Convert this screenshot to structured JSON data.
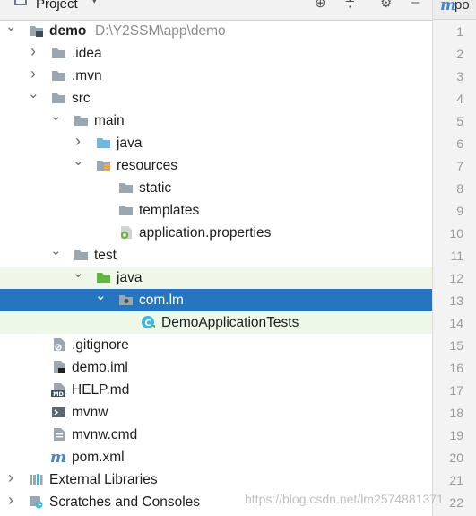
{
  "header": {
    "title": "Project",
    "editor_tab": "po"
  },
  "tree": [
    {
      "id": "demo",
      "label": "demo",
      "path": "D:\\Y2SSM\\app\\demo",
      "bold": true,
      "depth": 0,
      "arrow": "expanded",
      "icon": "module-folder"
    },
    {
      "id": "idea",
      "label": ".idea",
      "depth": 1,
      "arrow": "collapsed",
      "icon": "folder"
    },
    {
      "id": "mvn",
      "label": ".mvn",
      "depth": 1,
      "arrow": "collapsed",
      "icon": "folder"
    },
    {
      "id": "src",
      "label": "src",
      "depth": 1,
      "arrow": "expanded",
      "icon": "folder"
    },
    {
      "id": "main",
      "label": "main",
      "depth": 2,
      "arrow": "expanded",
      "icon": "folder"
    },
    {
      "id": "java-main",
      "label": "java",
      "depth": 3,
      "arrow": "collapsed",
      "icon": "source-folder"
    },
    {
      "id": "resources",
      "label": "resources",
      "depth": 3,
      "arrow": "expanded",
      "icon": "resources-folder"
    },
    {
      "id": "static",
      "label": "static",
      "depth": 4,
      "arrow": "none",
      "icon": "folder"
    },
    {
      "id": "templates",
      "label": "templates",
      "depth": 4,
      "arrow": "none",
      "icon": "folder"
    },
    {
      "id": "app-props",
      "label": "application.properties",
      "depth": 4,
      "arrow": "none",
      "icon": "spring-properties"
    },
    {
      "id": "test",
      "label": "test",
      "depth": 2,
      "arrow": "expanded",
      "icon": "folder"
    },
    {
      "id": "java-test",
      "label": "java",
      "depth": 3,
      "arrow": "expanded",
      "icon": "test-folder",
      "highlight": "green"
    },
    {
      "id": "com-lm",
      "label": "com.lm",
      "depth": 4,
      "arrow": "expanded",
      "icon": "package",
      "selected": true
    },
    {
      "id": "demo-tests",
      "label": "DemoApplicationTests",
      "depth": 5,
      "arrow": "none",
      "icon": "class",
      "highlight": "green"
    },
    {
      "id": "gitignore",
      "label": ".gitignore",
      "depth": 1,
      "arrow": "none",
      "icon": "ignore-file"
    },
    {
      "id": "demo-iml",
      "label": "demo.iml",
      "depth": 1,
      "arrow": "none",
      "icon": "iml-file"
    },
    {
      "id": "help-md",
      "label": "HELP.md",
      "depth": 1,
      "arrow": "none",
      "icon": "markdown-file"
    },
    {
      "id": "mvnw",
      "label": "mvnw",
      "depth": 1,
      "arrow": "none",
      "icon": "shell-file"
    },
    {
      "id": "mvnw-cmd",
      "label": "mvnw.cmd",
      "depth": 1,
      "arrow": "none",
      "icon": "text-file"
    },
    {
      "id": "pom",
      "label": "pom.xml",
      "depth": 1,
      "arrow": "none",
      "icon": "maven-file"
    },
    {
      "id": "ext-libs",
      "label": "External Libraries",
      "depth": 0,
      "arrow": "collapsed",
      "icon": "libraries"
    },
    {
      "id": "scratches",
      "label": "Scratches and Consoles",
      "depth": 0,
      "arrow": "collapsed",
      "icon": "scratches"
    }
  ],
  "gutter": {
    "line_numbers": [
      "1",
      "2",
      "3",
      "4",
      "5",
      "6",
      "7",
      "8",
      "9",
      "10",
      "11",
      "12",
      "13",
      "14",
      "15",
      "16",
      "17",
      "18",
      "19",
      "20",
      "21",
      "22"
    ]
  },
  "watermark": "https://blog.csdn.net/lm2574881371",
  "colors": {
    "selection": "#2675bf",
    "test_highlight": "#eff7e8",
    "folder": "#9aa7b0",
    "source_folder": "#6fb8dc",
    "test_folder": "#62b543"
  }
}
